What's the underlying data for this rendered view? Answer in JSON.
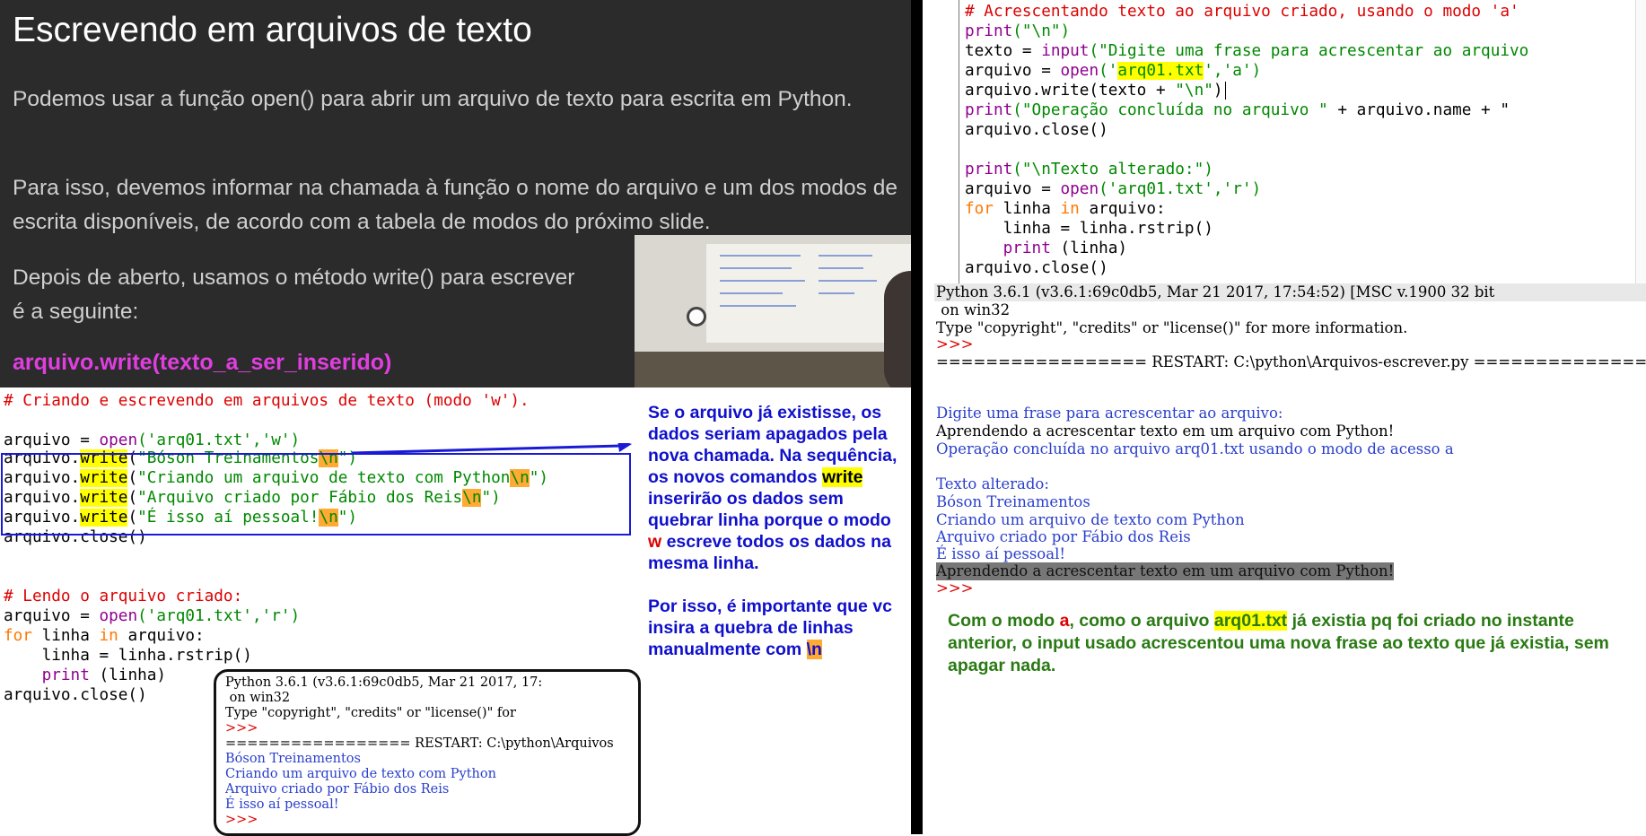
{
  "slide": {
    "title": "Escrevendo em arquivos de texto",
    "para1": "Podemos usar a função open() para abrir um arquivo de texto para escrita em Python.",
    "para2": "Para isso, devemos informar na chamada à função o nome do arquivo e um dos modos de escrita disponíveis, de acordo com a tabela de modos do próximo slide.",
    "para3_line1": "Depois de aberto, usamos o método write() para escrever",
    "para3_line2": "é a seguinte:",
    "code": "arquivo.write(texto_a_ser_inserido)"
  },
  "editor_left": {
    "comment_write": "# Criando e escrevendo em arquivos de texto (modo 'w').",
    "open_w_prefix": "arquivo = ",
    "open_fn": "open",
    "open_w_args": "('arq01.txt','w')",
    "writes": [
      {
        "prefix": "arquivo.",
        "method": "write",
        "open_paren": "(",
        "text": "\"Bóson Treinamentos",
        "nl": "\\n",
        "close": "\")"
      },
      {
        "prefix": "arquivo.",
        "method": "write",
        "open_paren": "(",
        "text": "\"Criando um arquivo de texto com Python",
        "nl": "\\n",
        "close": "\")"
      },
      {
        "prefix": "arquivo.",
        "method": "write",
        "open_paren": "(",
        "text": "\"Arquivo criado por Fábio dos Reis",
        "nl": "\\n",
        "close": "\")"
      },
      {
        "prefix": "arquivo.",
        "method": "write",
        "open_paren": "(",
        "text": "\"É isso aí pessoal!",
        "nl": "\\n",
        "close": "\")"
      }
    ],
    "close_stmt": "arquivo.close()",
    "comment_read": "# Lendo o arquivo criado:",
    "open_r_prefix": "arquivo = ",
    "open_r_args": "('arq01.txt','r')",
    "for_kw": "for",
    "for_mid": " linha ",
    "in_kw": "in",
    "for_end": " arquivo:",
    "strip_line": "    linha = linha.rstrip()",
    "print_indent": "    ",
    "print_kw": "print",
    "print_args": " (linha)",
    "close_stmt2": "arquivo.close()"
  },
  "shell_left": {
    "lines": [
      {
        "text": "Python 3.6.1 (v3.6.1:69c0db5, Mar 21 2017, 17:",
        "color": "#000000"
      },
      {
        "text": " on win32",
        "color": "#000000"
      },
      {
        "text": "Type \"copyright\", \"credits\" or \"license()\" for",
        "color": "#000000"
      },
      {
        "text": ">>>",
        "color": "#dd0000"
      },
      {
        "text": "================= RESTART: C:\\python\\Arquivos",
        "color": "#000000"
      },
      {
        "text": "Bóson Treinamentos",
        "color": "#2a3fcc"
      },
      {
        "text": "Criando um arquivo de texto com Python",
        "color": "#2a3fcc"
      },
      {
        "text": "Arquivo criado por Fábio dos Reis",
        "color": "#2a3fcc"
      },
      {
        "text": "É isso aí pessoal!",
        "color": "#2a3fcc"
      },
      {
        "text": ">>>",
        "color": "#dd0000"
      }
    ]
  },
  "note": {
    "p1_a": "Se o arquivo já existisse, os dados seriam apagados pela nova chamada. Na sequência, os novos comandos ",
    "p1_write": "write",
    "p1_b": " inserirão os dados sem quebrar linha porque o modo ",
    "p1_w": "w",
    "p1_c": " escreve todos os dados na mesma linha.",
    "p2_a": "Por isso, é importante que vc insira a quebra de linhas manualmente com ",
    "p2_nl": "\\n"
  },
  "editor_right": {
    "comment": "# Acrescentando texto ao arquivo criado, usando o modo 'a'",
    "print_nl": "(\"\\n\")",
    "texto_prefix": "texto = ",
    "input_kw": "input",
    "input_args": "(\"Digite uma frase para acrescentar ao arquivo",
    "open_a_prefix": "arquivo = ",
    "open_a_q1": "('",
    "open_a_file": "arq01.txt",
    "open_a_q2": "','a')",
    "write_line": "arquivo.write(texto + ",
    "write_str": "\"\\n\"",
    "write_end": ")",
    "print_op_str": "(\"Operação concluída no arquivo \"",
    "print_op_tail": " + arquivo.name + \"",
    "close_stmt": "arquivo.close()",
    "print_alt": "(\"\\nTexto alterado:\")",
    "open_r_args": "('arq01.txt','r')",
    "print_kw": "print",
    "for_kw": "for",
    "in_kw": "in",
    "for_line_mid": " linha ",
    "for_line_end": " arquivo:",
    "strip_line": "    linha = linha.rstrip()",
    "print_line_args": " (linha)",
    "close_stmt2": "arquivo.close()"
  },
  "shell_right": {
    "header": "Python 3.6.1 (v3.6.1:69c0db5, Mar 21 2017, 17:54:52) [MSC v.1900 32 bit",
    "on_win": " on win32",
    "type_line": "Type \"copyright\", \"credits\" or \"license()\" for more information.",
    "prompt": ">>>",
    "restart": "================= RESTART: C:\\python\\Arquivos-escrever.py ==============",
    "prompt_q": "Digite uma frase para acrescentar ao arquivo:",
    "user_input": "Aprendendo a acrescentar texto em um arquivo com Python!",
    "op_done": "Operação concluída no arquivo arq01.txt usando o modo de acesso a",
    "alt_header": "Texto alterado:",
    "out_lines": [
      "Bóson Treinamentos",
      "Criando um arquivo de texto com Python",
      "Arquivo criado por Fábio dos Reis",
      "É isso aí pessoal!"
    ],
    "selected_line": "Aprendendo a acrescentar texto em um arquivo com Python!",
    "end_prompt": ">>>"
  },
  "green_note": {
    "a": "Com o modo ",
    "mode": "a",
    "b": ", como o arquivo ",
    "file": "arq01.txt",
    "c": " já existia pq foi criado no instante anterior, o input usado acrescentou uma nova frase ao texto que já existia, sem apagar nada."
  }
}
